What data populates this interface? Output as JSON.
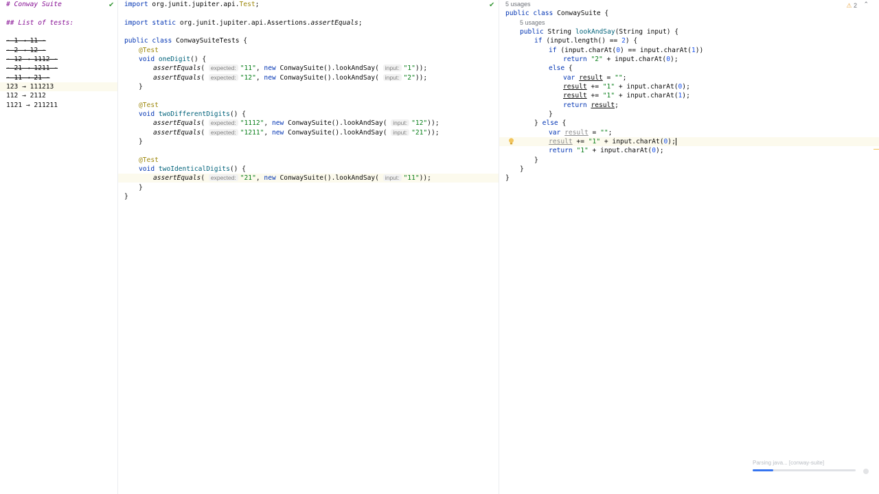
{
  "markdown": {
    "title": "# Conway Suite",
    "section": "## List of tests:",
    "done_items": [
      "- 1 → 11 -",
      "- 2 → 12 -",
      "- 12 → 1112 -",
      "- 21 → 1211 -",
      "- 11 → 21 -"
    ],
    "open_items": [
      "123 → 111213",
      "112 → 2112",
      "1121 → 211211"
    ]
  },
  "tests_file": {
    "import1_kw": "import",
    "import1_path": " org.junit.jupiter.api.",
    "import1_class": "Test",
    "import2_kw": "import static",
    "import2_path": " org.junit.jupiter.api.Assertions.",
    "import2_member": "assertEquals",
    "class_decl_kw": "public class",
    "class_name": " ConwaySuiteTests {",
    "annotation": "@Test",
    "void_kw": "void",
    "methods": [
      "oneDigit",
      "twoDifferentDigits",
      "twoIdenticalDigits"
    ],
    "assert_fn": "assertEquals",
    "hint_expected": "expected:",
    "hint_input": "input:",
    "new_kw": "new",
    "ctor_call": " ConwaySuite().lookAndSay(",
    "asserts": [
      {
        "expected": "\"11\"",
        "input": "\"1\""
      },
      {
        "expected": "\"12\"",
        "input": "\"2\""
      },
      {
        "expected": "\"1112\"",
        "input": "\"12\""
      },
      {
        "expected": "\"1211\"",
        "input": "\"21\""
      },
      {
        "expected": "\"21\"",
        "input": "\"11\""
      }
    ]
  },
  "source_file": {
    "usages_class": "5 usages",
    "usages_method": "5 usages",
    "class_kw": "public class",
    "class_name": " ConwaySuite {",
    "method_kw": "public",
    "method_type": " String ",
    "method_name": "lookAndSay",
    "method_params": "(String input) {",
    "if_kw": "if",
    "else_kw": "else",
    "return_kw": "return",
    "var_kw": "var",
    "result_var": "result",
    "warnings_count": "2",
    "status": "Parsing java... [conway-suite]",
    "progress": 0.2
  }
}
